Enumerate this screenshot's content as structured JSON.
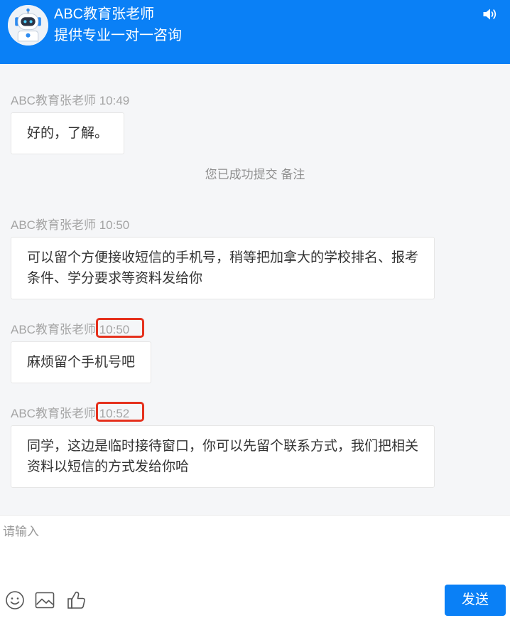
{
  "header": {
    "title": "ABC教育张老师",
    "subtitle": "提供专业一对一咨询",
    "avatar_icon": "robot-icon",
    "sound_icon": "speaker-icon"
  },
  "messages": [
    {
      "kind": "agent",
      "sender": "ABC教育张老师",
      "time": "10:49",
      "time_highlighted": false,
      "lines": [
        "好的，了解。"
      ]
    },
    {
      "kind": "system",
      "text": "您已成功提交 备注"
    },
    {
      "kind": "agent",
      "sender": "ABC教育张老师",
      "time": "10:50",
      "time_highlighted": false,
      "lines": [
        "可以留个方便接收短信的手机号，稍等把加拿大的学校排名、报考",
        "条件、学分要求等资料发给你"
      ]
    },
    {
      "kind": "agent",
      "sender": "ABC教育张老师",
      "time": "10:50",
      "time_highlighted": true,
      "lines": [
        "麻烦留个手机号吧"
      ]
    },
    {
      "kind": "agent",
      "sender": "ABC教育张老师",
      "time": "10:52",
      "time_highlighted": true,
      "lines": [
        "同学，这边是临时接待窗口，你可以先留个联系方式，我们把相关",
        "资料以短信的方式发给你哈"
      ]
    }
  ],
  "input": {
    "placeholder": "请输入"
  },
  "toolbar": {
    "icons": [
      "smile-icon",
      "image-icon",
      "thumbs-up-icon"
    ],
    "send_label": "发送"
  },
  "colors": {
    "brand": "#0a80f6",
    "highlight": "#e5311d",
    "chat_background": "#f5f6f8",
    "bubble_background": "#ffffff"
  }
}
